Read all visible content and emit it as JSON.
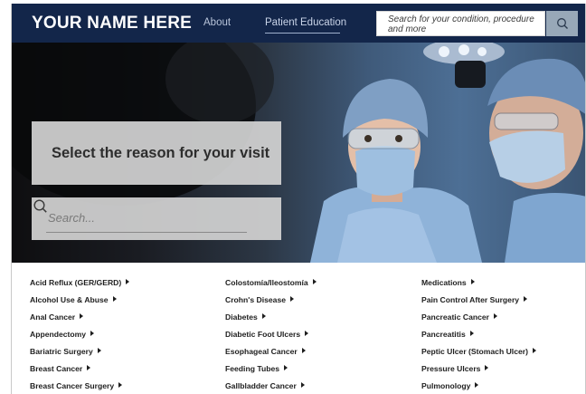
{
  "header": {
    "brand": "YOUR NAME HERE",
    "nav": [
      {
        "label": "About"
      },
      {
        "label": "Patient Education"
      }
    ],
    "search_placeholder": "Search for your condition, procedure and more",
    "search_icon": "search-icon"
  },
  "hero": {
    "reason_title": "Select the reason for your visit",
    "search_placeholder": "Search...",
    "search_icon": "search-icon"
  },
  "links": {
    "col1": [
      "Acid Reflux (GER/GERD)",
      "Alcohol Use & Abuse",
      "Anal Cancer",
      "Appendectomy",
      "Bariatric Surgery",
      "Breast Cancer",
      "Breast Cancer Surgery"
    ],
    "col2": [
      "Colostomía/Ileostomía",
      "Crohn's Disease",
      "Diabetes",
      "Diabetic Foot Ulcers",
      "Esophageal Cancer",
      "Feeding Tubes",
      "Gallbladder Cancer"
    ],
    "col3": [
      "Medications",
      "Pain Control After Surgery",
      "Pancreatic Cancer",
      "Pancreatitis",
      "Peptic Ulcer (Stomach Ulcer)",
      "Pressure Ulcers",
      "Pulmonology"
    ]
  },
  "colors": {
    "header_bg": "#13264a",
    "search_button": "#98a8b8",
    "overlay_box": "#d2d2d2"
  }
}
